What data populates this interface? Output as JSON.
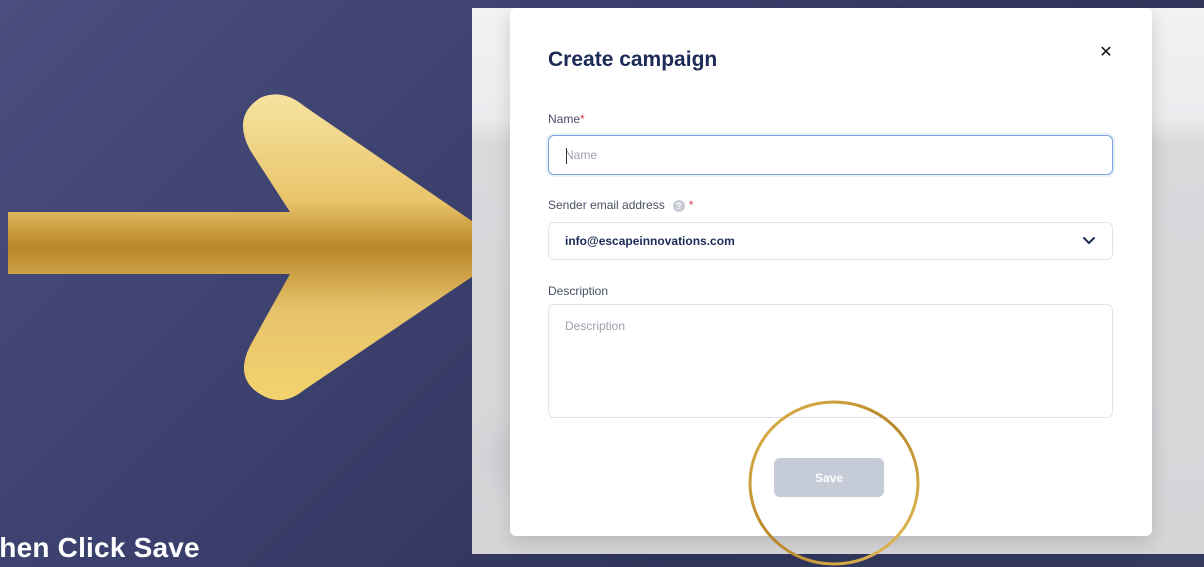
{
  "caption": "Then Click Save",
  "modal": {
    "title": "Create campaign",
    "close_icon": "close-icon"
  },
  "form": {
    "name": {
      "label": "Name",
      "required_mark": "*",
      "placeholder": "Name",
      "value": ""
    },
    "sender": {
      "label": "Sender email address",
      "required_mark": "*",
      "info_icon": "info-icon",
      "value": "info@escapeinnovations.com",
      "dropdown_icon": "chevron-down-icon"
    },
    "description": {
      "label": "Description",
      "placeholder": "Description"
    },
    "save_label": "Save"
  },
  "colors": {
    "arrow_gold": "#c8932a",
    "ring_gold": "#c99a2e",
    "title": "#1b2a56",
    "save_disabled": "#c6cbd8",
    "required": "#e03a4a"
  }
}
